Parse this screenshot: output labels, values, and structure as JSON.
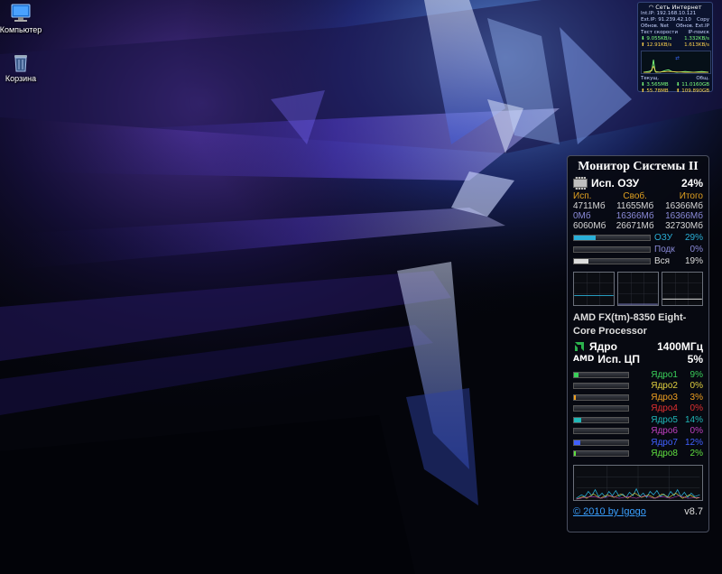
{
  "desktop": {
    "icons": [
      {
        "label": "Компьютер",
        "icon": "computer-icon"
      },
      {
        "label": "Корзина",
        "icon": "recycle-bin-icon"
      }
    ]
  },
  "network": {
    "title": "Сеть Интернет",
    "int_ip_label": "Int.IP:",
    "int_ip": "192.168.10.121",
    "ext_ip_label": "Ext.IP:",
    "ext_ip": "91.239.42.10",
    "copy_label": "Copy",
    "refresh_net": "Обнов. Net",
    "refresh_ext": "Обнов. Ext.IP",
    "speed_test": "Тест скорости",
    "ip_search": "IP-поиск",
    "down1": "9.055KB/s",
    "down2": "1.332KB/s",
    "up1": "12.91KB/s",
    "up2": "1.613KB/s",
    "current_label": "Текущ.",
    "total_label": "Общ.",
    "cur_down": "3.565MB",
    "cur_up": "55.78MB",
    "tot_down": "11.0160GB",
    "tot_up": "109.890GB",
    "colors": {
      "download": "#7cff7c",
      "upload": "#ffd34d"
    }
  },
  "sysmon": {
    "title": "Монитор Системы II",
    "ram": {
      "label": "Исп. ОЗУ",
      "percent": "24%",
      "headers": [
        "Исп.",
        "Своб.",
        "Итого"
      ],
      "rows": [
        {
          "used": "4711Мб",
          "free": "11655Мб",
          "total": "16366Мб",
          "color": "#d8d8d8"
        },
        {
          "used": "0Мб",
          "free": "16366Мб",
          "total": "16366Мб",
          "color": "#8a8ad8"
        },
        {
          "used": "6060Мб",
          "free": "26671Мб",
          "total": "32730Мб",
          "color": "#d8d8d8"
        }
      ],
      "bars": [
        {
          "name": "ОЗУ",
          "percent": "29%",
          "value": 0.29,
          "color": "#2ab0d8",
          "text_color": "#2ab0d8"
        },
        {
          "name": "Подк",
          "percent": "0%",
          "value": 0.0,
          "color": "#8a8ad8",
          "text_color": "#8a8ad8"
        },
        {
          "name": "Вся",
          "percent": "19%",
          "value": 0.19,
          "color": "#dcdcdc",
          "text_color": "#dcdcdc"
        }
      ]
    },
    "cpu": {
      "name": "AMD FX(tm)-8350 Eight-Core Processor",
      "brand": "AMD",
      "core_label": "Ядро",
      "frequency": "1400МГц",
      "usage_label": "Исп. ЦП",
      "usage_percent": "5%",
      "cores": [
        {
          "name": "Ядро1",
          "percent": "9%",
          "value": 0.09,
          "color": "#3ad05a"
        },
        {
          "name": "Ядро2",
          "percent": "0%",
          "value": 0.0,
          "color": "#e0d040"
        },
        {
          "name": "Ядро3",
          "percent": "3%",
          "value": 0.03,
          "color": "#f0a020"
        },
        {
          "name": "Ядро4",
          "percent": "0%",
          "value": 0.0,
          "color": "#e03030"
        },
        {
          "name": "Ядро5",
          "percent": "14%",
          "value": 0.14,
          "color": "#20b8b8"
        },
        {
          "name": "Ядро6",
          "percent": "0%",
          "value": 0.0,
          "color": "#c040c0"
        },
        {
          "name": "Ядро7",
          "percent": "12%",
          "value": 0.12,
          "color": "#4060ff"
        },
        {
          "name": "Ядро8",
          "percent": "2%",
          "value": 0.02,
          "color": "#60e040"
        }
      ]
    },
    "footer": {
      "copyright": "© 2010 by Igogo",
      "version": "v8.7"
    }
  }
}
